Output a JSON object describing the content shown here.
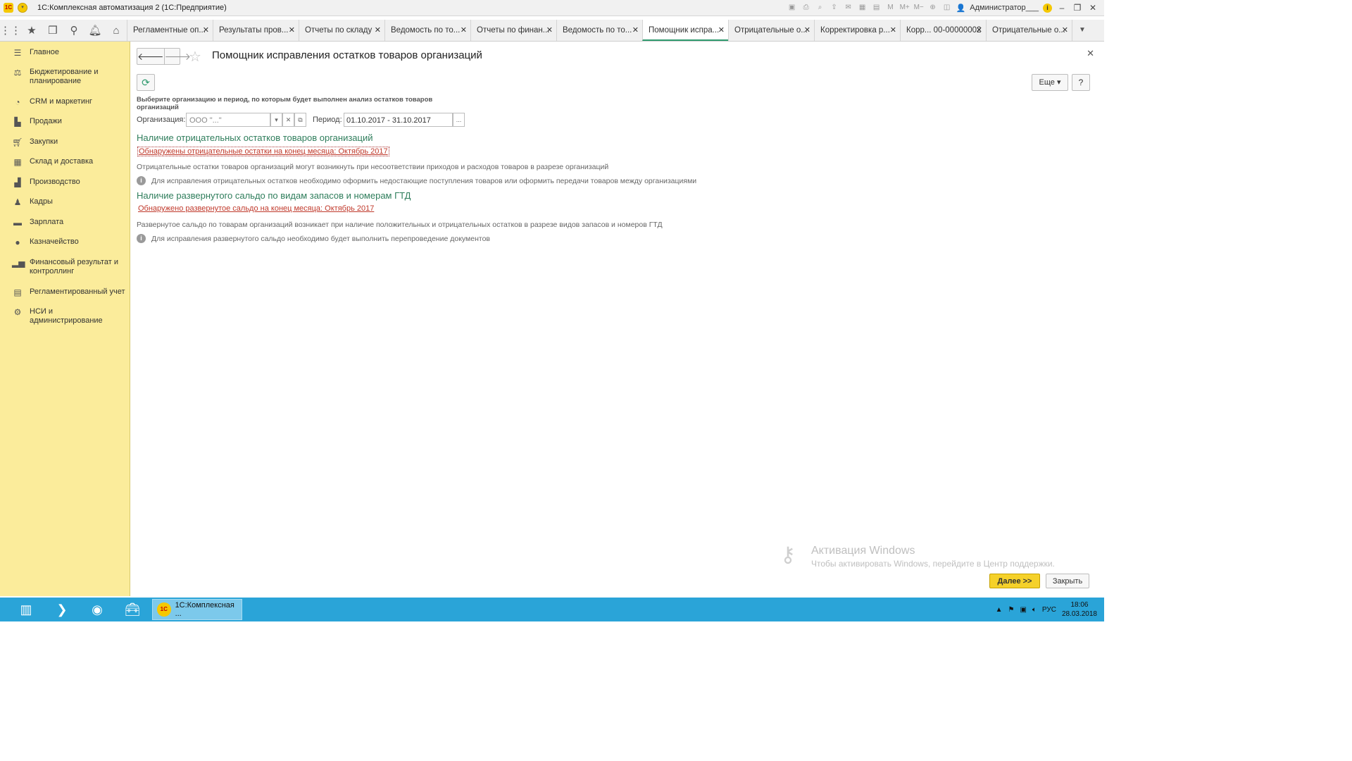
{
  "window": {
    "logo": "1С",
    "title": "1С:Комплексная автоматизация 2  (1С:Предприятие)",
    "user": "Администратор___"
  },
  "tabs": [
    {
      "label": "Регламентные оп..."
    },
    {
      "label": "Результаты пров..."
    },
    {
      "label": "Отчеты по складу"
    },
    {
      "label": "Ведомость по то..."
    },
    {
      "label": "Отчеты по финан..."
    },
    {
      "label": "Ведомость по то..."
    },
    {
      "label": "Помощник испра..."
    },
    {
      "label": "Отрицательные о..."
    },
    {
      "label": "Корректировка р..."
    },
    {
      "label": "Корр... 00-00000002"
    },
    {
      "label": "Отрицательные о..."
    }
  ],
  "sidebar": {
    "items": [
      {
        "label": "Главное",
        "icon": "menu-icon"
      },
      {
        "label": "Бюджетирование и планирование",
        "icon": "budget-icon"
      },
      {
        "label": "CRM и маркетинг",
        "icon": "pie-chart-icon"
      },
      {
        "label": "Продажи",
        "icon": "bag-icon"
      },
      {
        "label": "Закупки",
        "icon": "cart-icon"
      },
      {
        "label": "Склад и доставка",
        "icon": "warehouse-icon"
      },
      {
        "label": "Производство",
        "icon": "factory-icon"
      },
      {
        "label": "Кадры",
        "icon": "person-icon"
      },
      {
        "label": "Зарплата",
        "icon": "card-icon"
      },
      {
        "label": "Казначейство",
        "icon": "coin-icon"
      },
      {
        "label": "Финансовый результат и контроллинг",
        "icon": "bar-chart-icon"
      },
      {
        "label": "Регламентированный учет",
        "icon": "calculator-icon"
      },
      {
        "label": "НСИ и администрирование",
        "icon": "gear-icon"
      }
    ]
  },
  "form": {
    "title": "Помощник исправления остатков товаров организаций",
    "more_label": "Еще",
    "help_label": "?",
    "instruction": "Выберите организацию и период, по которым будет выполнен анализ остатков товаров организаций",
    "org_label": "Организация:",
    "org_value": "ООО \"...\"",
    "period_label": "Период:",
    "period_value": "01.10.2017 - 31.10.2017",
    "section1": {
      "title": "Наличие отрицательных остатков товаров организаций",
      "alert": "Обнаружены отрицательные остатки на конец месяца: Октябрь 2017",
      "description": "Отрицательные остатки товаров организаций могут возникнуть при несоответствии приходов и расходов товаров в разрезе организаций",
      "info": "Для исправления отрицательных остатков необходимо оформить недостающие поступления товаров или оформить передачи товаров между организациями"
    },
    "section2": {
      "title": "Наличие развернутого сальдо по видам запасов и номерам ГТД",
      "alert": "Обнаружено развернутое сальдо на конец месяца: Октябрь 2017",
      "description": "Развернутое сальдо по товарам организаций возникает при наличие положительных и отрицательных остатков в разрезе видов запасов и номеров ГТД",
      "info": "Для исправления развернутого сальдо необходимо будет выполнить перепроведение документов"
    },
    "next_label": "Далее >>",
    "close_label": "Закрыть"
  },
  "watermark": {
    "title": "Активация Windows",
    "subtitle": "Чтобы активировать Windows, перейдите в Центр поддержки."
  },
  "taskbar": {
    "active_task": "1С:Комплексная ...",
    "lang": "РУС",
    "time": "18:06",
    "date": "28.03.2018"
  },
  "colors": {
    "sidebar_bg": "#fbec9b",
    "accent_green": "#2e7d5b",
    "alert_red": "#c0392b",
    "primary_button": "#f5d12a",
    "taskbar": "#2aa4d8"
  }
}
